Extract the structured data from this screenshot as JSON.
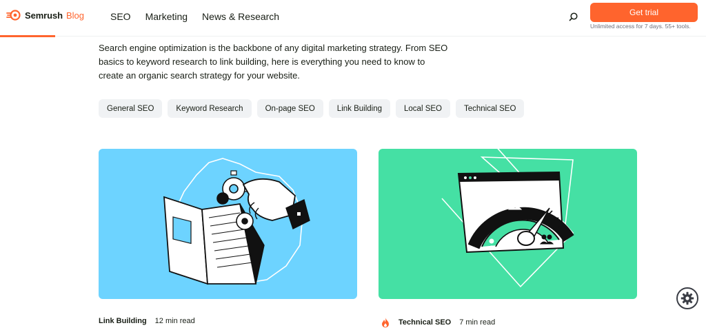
{
  "brand": {
    "name": "Semrush",
    "suffix": "Blog",
    "accent": "#ff642d"
  },
  "nav": {
    "items": [
      "SEO",
      "Marketing",
      "News & Research"
    ]
  },
  "header": {
    "search_icon": "search-icon",
    "trial_label": "Get trial",
    "trial_sub": "Unlimited access for 7 days. 55+ tools."
  },
  "intro": "Search engine optimization is the backbone of any digital marketing strategy. From SEO basics to keyword research to link building, here is everything you need to know to create an organic search strategy for your website.",
  "tags": [
    "General SEO",
    "Keyword Research",
    "On-page SEO",
    "Link Building",
    "Local SEO",
    "Technical SEO"
  ],
  "cards": [
    {
      "category": "Link Building",
      "read_time": "12 min read",
      "bg": "#6dd3ff",
      "icon": ""
    },
    {
      "category": "Technical SEO",
      "read_time": "7 min read",
      "bg": "#45e0a4",
      "icon": "fire-icon"
    }
  ],
  "widget": {
    "icon": "gear-icon"
  }
}
